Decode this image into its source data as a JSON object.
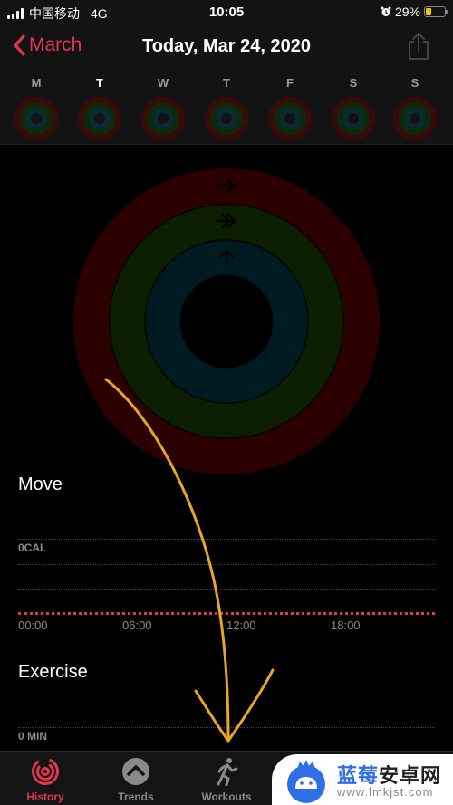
{
  "status_bar": {
    "carrier": "中国移动",
    "network": "4G",
    "time": "10:05",
    "battery_percent": "29%",
    "battery_level": 0.29,
    "alarm_icon": "alarm-clock-icon"
  },
  "header": {
    "back_label": "March",
    "title": "Today, Mar 24, 2020",
    "share_icon": "share-icon"
  },
  "week": {
    "selected_index": 1,
    "days": [
      {
        "label": "M"
      },
      {
        "label": "T"
      },
      {
        "label": "W"
      },
      {
        "label": "T"
      },
      {
        "label": "F"
      },
      {
        "label": "S"
      },
      {
        "label": "S"
      }
    ]
  },
  "activity_rings": {
    "move_progress": 0,
    "exercise_progress": 0,
    "stand_progress": 0,
    "colors": {
      "move": "#2a0000",
      "exercise": "#0b1f00",
      "stand": "#001a22"
    }
  },
  "move_section": {
    "title": "Move",
    "y_label": "0CAL",
    "x_ticks": [
      "00:00",
      "06:00",
      "12:00",
      "18:00"
    ],
    "goal_line_color": "#e0384e"
  },
  "exercise_section": {
    "title": "Exercise",
    "y_label": "0 MIN"
  },
  "tabbar": {
    "active_index": 0,
    "tabs": [
      {
        "label": "History",
        "icon": "history-rings-icon"
      },
      {
        "label": "Trends",
        "icon": "trends-chevron-up-icon"
      },
      {
        "label": "Workouts",
        "icon": "running-figure-icon"
      }
    ]
  },
  "watermark": {
    "title_blue": "蓝莓",
    "title_dark": "安卓网",
    "url": "www.lmkjst.com"
  },
  "colors": {
    "accent": "#e0384e",
    "annotation": "#e8a526"
  }
}
